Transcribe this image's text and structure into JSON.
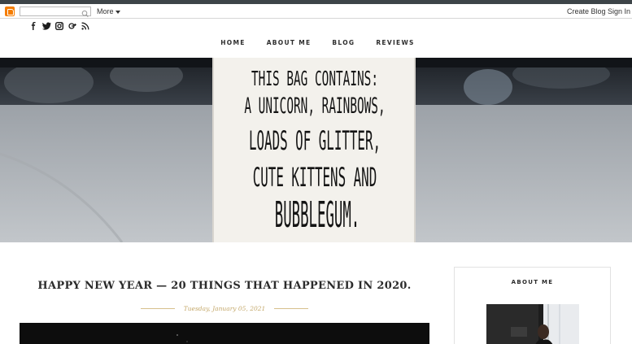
{
  "blogger_bar": {
    "search_value": "",
    "more_label": "More",
    "create_blog_label": "Create Blog",
    "sign_in_label": "Sign In"
  },
  "social_icons": [
    "facebook-icon",
    "twitter-icon",
    "instagram-icon",
    "google-plus-icon",
    "rss-icon"
  ],
  "main_nav": {
    "items": [
      "HOME",
      "ABOUT ME",
      "BLOG",
      "REVIEWS"
    ]
  },
  "hero": {
    "bag_text_lines": [
      "THIS BAG CONTAINS:",
      "A UNICORN, RAINBOWS,",
      "LOADS OF GLITTER,",
      "CUTE KITTENS AND",
      "BUBBLEGUM."
    ]
  },
  "post": {
    "title": "HAPPY NEW YEAR — 20 THINGS THAT HAPPENED IN 2020.",
    "date": "Tuesday, January 05, 2021"
  },
  "sidebar": {
    "title": "ABOUT ME"
  },
  "colors": {
    "accent_gold": "#c4a86a",
    "top_strip": "#3d4448",
    "blogger_orange": "#f57d00"
  }
}
